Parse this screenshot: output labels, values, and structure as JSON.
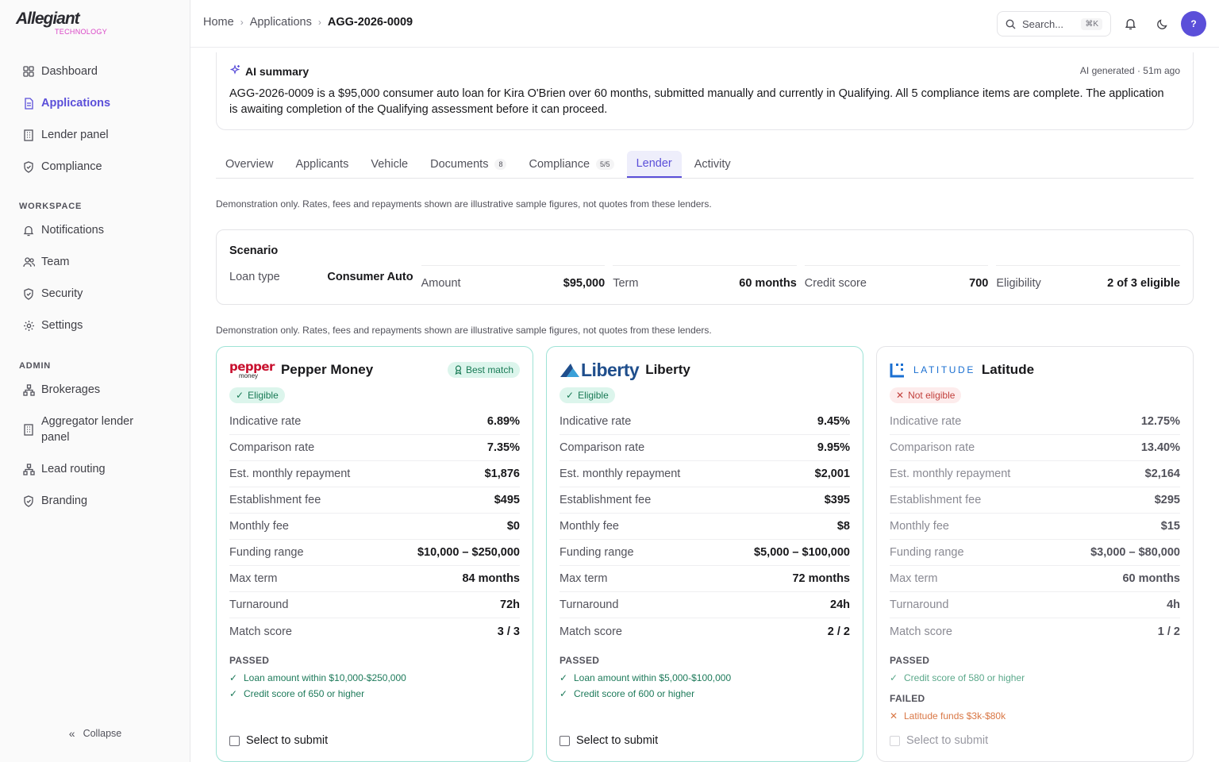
{
  "brand": {
    "name": "Allegiant",
    "sub": "TECHNOLOGY"
  },
  "sidebar": {
    "main_items": [
      {
        "label": "Dashboard",
        "icon": "grid-icon"
      },
      {
        "label": "Applications",
        "icon": "file-icon",
        "active": true
      },
      {
        "label": "Lender panel",
        "icon": "building-icon"
      },
      {
        "label": "Compliance",
        "icon": "shield-icon"
      }
    ],
    "workspace_heading": "WORKSPACE",
    "workspace_items": [
      {
        "label": "Notifications",
        "icon": "bell-icon"
      },
      {
        "label": "Team",
        "icon": "users-icon"
      },
      {
        "label": "Security",
        "icon": "shield-icon"
      },
      {
        "label": "Settings",
        "icon": "gear-icon"
      }
    ],
    "admin_heading": "ADMIN",
    "admin_items": [
      {
        "label": "Brokerages",
        "icon": "network-icon"
      },
      {
        "label": "Aggregator lender panel",
        "icon": "building-icon"
      },
      {
        "label": "Lead routing",
        "icon": "network-icon"
      },
      {
        "label": "Branding",
        "icon": "shield-icon"
      }
    ],
    "collapse_label": "Collapse"
  },
  "topbar": {
    "breadcrumb": [
      "Home",
      "Applications",
      "AGG-2026-0009"
    ],
    "search_placeholder": "Search...",
    "search_shortcut": "⌘K",
    "avatar_initial": "?"
  },
  "ai_summary": {
    "title": "AI summary",
    "meta": "AI generated · 51m ago",
    "text": "AGG-2026-0009 is a $95,000 consumer auto loan for Kira O'Brien over 60 months, submitted manually and currently in Qualifying. All 5 compliance items are complete. The application is awaiting completion of the Qualifying assessment before it can proceed."
  },
  "tabs": [
    {
      "label": "Overview"
    },
    {
      "label": "Applicants"
    },
    {
      "label": "Vehicle"
    },
    {
      "label": "Documents",
      "count": "8"
    },
    {
      "label": "Compliance",
      "count": "5/5"
    },
    {
      "label": "Lender",
      "active": true
    },
    {
      "label": "Activity"
    }
  ],
  "disclaimer": "Demonstration only. Rates, fees and repayments shown are illustrative sample figures, not quotes from these lenders.",
  "scenario": {
    "title": "Scenario",
    "fields": [
      {
        "label": "Loan type",
        "value": "Consumer Auto"
      },
      {
        "label": "Amount",
        "value": "$95,000"
      },
      {
        "label": "Term",
        "value": "60 months"
      },
      {
        "label": "Credit score",
        "value": "700"
      },
      {
        "label": "Eligibility",
        "value": "2 of 3 eligible"
      }
    ]
  },
  "lenders": [
    {
      "name": "Pepper Money",
      "logo_text": "pepper",
      "logo_sub": "money",
      "best_match": "Best match",
      "status": "Eligible",
      "eligible": true,
      "rows": [
        {
          "label": "Indicative rate",
          "value": "6.89%"
        },
        {
          "label": "Comparison rate",
          "value": "7.35%"
        },
        {
          "label": "Est. monthly repayment",
          "value": "$1,876"
        },
        {
          "label": "Establishment fee",
          "value": "$495"
        },
        {
          "label": "Monthly fee",
          "value": "$0"
        },
        {
          "label": "Funding range",
          "value": "$10,000 – $250,000"
        },
        {
          "label": "Max term",
          "value": "84 months"
        },
        {
          "label": "Turnaround",
          "value": "72h"
        },
        {
          "label": "Match score",
          "value": "3 / 3"
        }
      ],
      "passed_heading": "PASSED",
      "passed": [
        "Loan amount within $10,000-$250,000",
        "Credit score of 650 or higher"
      ],
      "select_label": "Select to submit"
    },
    {
      "name": "Liberty",
      "logo_text": "Liberty",
      "status": "Eligible",
      "eligible": true,
      "rows": [
        {
          "label": "Indicative rate",
          "value": "9.45%"
        },
        {
          "label": "Comparison rate",
          "value": "9.95%"
        },
        {
          "label": "Est. monthly repayment",
          "value": "$2,001"
        },
        {
          "label": "Establishment fee",
          "value": "$395"
        },
        {
          "label": "Monthly fee",
          "value": "$8"
        },
        {
          "label": "Funding range",
          "value": "$5,000 – $100,000"
        },
        {
          "label": "Max term",
          "value": "72 months"
        },
        {
          "label": "Turnaround",
          "value": "24h"
        },
        {
          "label": "Match score",
          "value": "2 / 2"
        }
      ],
      "passed_heading": "PASSED",
      "passed": [
        "Loan amount within $5,000-$100,000",
        "Credit score of 600 or higher"
      ],
      "select_label": "Select to submit"
    },
    {
      "name": "Latitude",
      "logo_text": "LATITUDE",
      "status": "Not eligible",
      "eligible": false,
      "rows": [
        {
          "label": "Indicative rate",
          "value": "12.75%"
        },
        {
          "label": "Comparison rate",
          "value": "13.40%"
        },
        {
          "label": "Est. monthly repayment",
          "value": "$2,164"
        },
        {
          "label": "Establishment fee",
          "value": "$295"
        },
        {
          "label": "Monthly fee",
          "value": "$15"
        },
        {
          "label": "Funding range",
          "value": "$3,000 – $80,000"
        },
        {
          "label": "Max term",
          "value": "60 months"
        },
        {
          "label": "Turnaround",
          "value": "4h"
        },
        {
          "label": "Match score",
          "value": "1 / 2"
        }
      ],
      "passed_heading": "PASSED",
      "passed": [
        "Credit score of 580 or higher"
      ],
      "failed_heading": "FAILED",
      "failed": [
        "Latitude funds $3k-$80k"
      ],
      "select_label": "Select to submit"
    }
  ],
  "colors": {
    "accent": "#5b4fd9",
    "eligible": "#187a55",
    "not_eligible": "#c2413d",
    "brand_pink": "#d944c6",
    "liberty_blue": "#1f4e8c",
    "latitude_blue": "#1a6fd1",
    "pepper_red": "#c8102e"
  }
}
